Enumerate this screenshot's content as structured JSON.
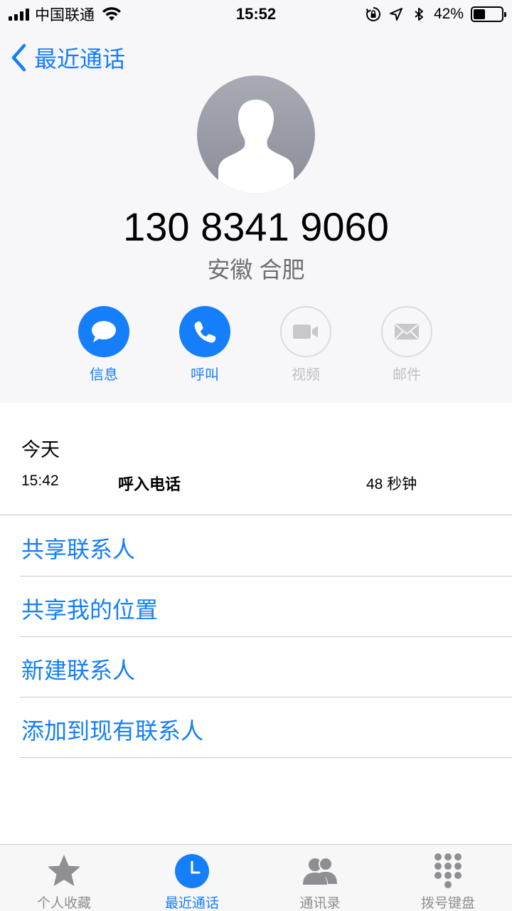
{
  "status_bar": {
    "carrier": "中国联通",
    "time": "15:52",
    "battery_percent": "42%",
    "battery_level": 0.42,
    "icons": [
      "signal-icon",
      "wifi-icon",
      "orientation-lock-icon",
      "location-icon",
      "bluetooth-icon",
      "battery-icon"
    ]
  },
  "nav": {
    "back_label": "最近通话"
  },
  "contact": {
    "phone_number": "130 8341 9060",
    "location": "安徽 合肥"
  },
  "actions": [
    {
      "label": "信息",
      "icon": "message-icon",
      "enabled": true
    },
    {
      "label": "呼叫",
      "icon": "phone-icon",
      "enabled": true
    },
    {
      "label": "视频",
      "icon": "video-icon",
      "enabled": false
    },
    {
      "label": "邮件",
      "icon": "mail-icon",
      "enabled": false
    }
  ],
  "recent": {
    "day": "今天",
    "time": "15:42",
    "type": "呼入电话",
    "duration": "48 秒钟"
  },
  "options": [
    "共享联系人",
    "共享我的位置",
    "新建联系人",
    "添加到现有联系人"
  ],
  "tabs": [
    {
      "label": "个人收藏",
      "icon": "star-icon",
      "active": false
    },
    {
      "label": "最近通话",
      "icon": "clock-icon",
      "active": true
    },
    {
      "label": "通讯录",
      "icon": "contacts-icon",
      "active": false
    },
    {
      "label": "拨号键盘",
      "icon": "keypad-icon",
      "active": false
    }
  ],
  "colors": {
    "accent": "#147efb",
    "header_bg": "#f7f7fa",
    "disabled": "#c0c0c4",
    "separator": "#c8c7cc"
  }
}
